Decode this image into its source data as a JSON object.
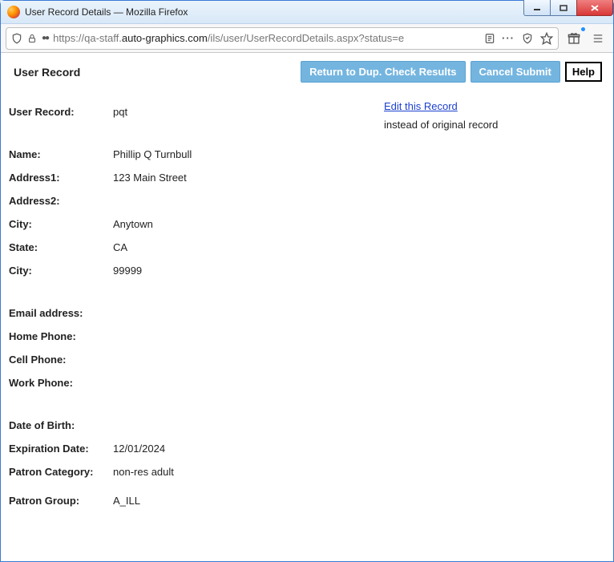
{
  "window": {
    "title": "User Record Details — Mozilla Firefox"
  },
  "url": {
    "prefix": "https://qa-staff.",
    "host": "auto-graphics.com",
    "path": "/ils/user/UserRecordDetails.aspx?status=e"
  },
  "page": {
    "title": "User Record"
  },
  "actions": {
    "return": "Return to Dup. Check Results",
    "cancel": "Cancel Submit",
    "help": "Help"
  },
  "edit": {
    "link": "Edit this Record",
    "note": "instead of original record"
  },
  "fields": {
    "user_record": {
      "label": "User Record:",
      "value": "pqt"
    },
    "name": {
      "label": "Name:",
      "value": "Phillip Q Turnbull"
    },
    "address1": {
      "label": "Address1:",
      "value": "123 Main Street"
    },
    "address2": {
      "label": "Address2:",
      "value": ""
    },
    "city": {
      "label": "City:",
      "value": "Anytown"
    },
    "state": {
      "label": "State:",
      "value": "CA"
    },
    "zip": {
      "label": "City:",
      "value": "99999"
    },
    "email": {
      "label": "Email address:",
      "value": ""
    },
    "home_phone": {
      "label": "Home Phone:",
      "value": ""
    },
    "cell_phone": {
      "label": "Cell Phone:",
      "value": ""
    },
    "work_phone": {
      "label": "Work Phone:",
      "value": ""
    },
    "dob": {
      "label": "Date of Birth:",
      "value": ""
    },
    "expiration": {
      "label": "Expiration Date:",
      "value": "12/01/2024"
    },
    "patron_category": {
      "label": "Patron Category:",
      "value": "non-res adult"
    },
    "patron_group": {
      "label": "Patron Group:",
      "value": "A_ILL"
    }
  }
}
